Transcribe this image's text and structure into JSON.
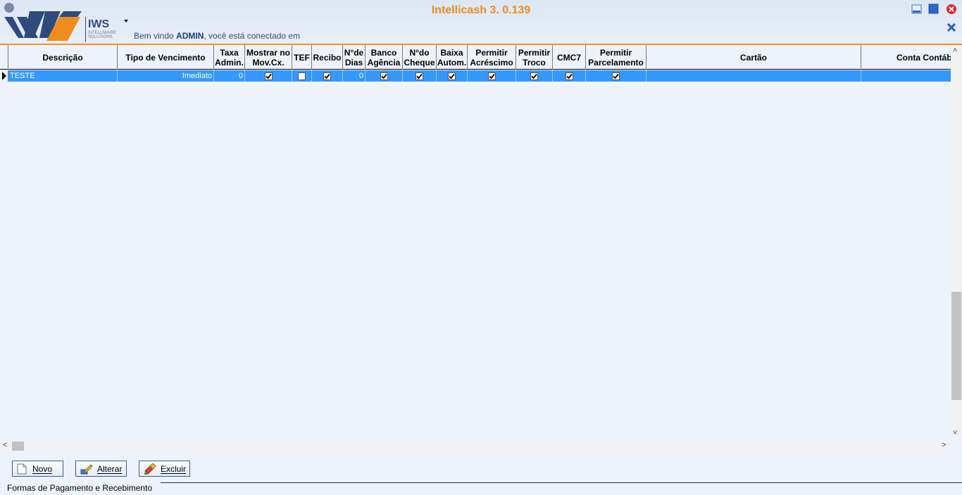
{
  "app": {
    "title": "Intellicash 3. 0.139",
    "welcome_prefix": "Bem vindo ",
    "user": "ADMIN",
    "welcome_suffix": ", você está conectado em",
    "logo_text": "IWS",
    "logo_sub": "INTELLIWARE SOLUTIONS"
  },
  "grid": {
    "columns": [
      "Descrição",
      "Tipo de Vencimento",
      "Taxa Admin.",
      "Mostrar no Mov.Cx.",
      "TEF",
      "Recibo",
      "N°de Dias",
      "Banco Agência",
      "N°do Cheque",
      "Baixa Autom.",
      "Permitir Acréscimo",
      "Permitir Troco",
      "CMC7",
      "Permitir Parcelamento",
      "Cartão",
      "Conta Contáb"
    ],
    "rows": [
      {
        "descricao": "TESTE",
        "tipo_vencimento": "Imediato",
        "taxa_admin": "0",
        "mostrar_mov_cx": true,
        "tef": false,
        "recibo": true,
        "n_dias": "0",
        "banco_agencia": true,
        "n_cheque": true,
        "baixa_autom": true,
        "permitir_acrescimo": true,
        "permitir_troco": true,
        "cmc7": true,
        "permitir_parcelamento": true,
        "cartao": "",
        "conta_contab": ""
      }
    ]
  },
  "buttons": {
    "novo": "Novo",
    "alterar": "Alterar",
    "excluir": "Excluir"
  },
  "status_tab": "Formas de Pagamento e Recebimento",
  "colors": {
    "accent": "#f08c1d",
    "selection": "#3399ff",
    "brand_blue": "#2d4b7c"
  }
}
